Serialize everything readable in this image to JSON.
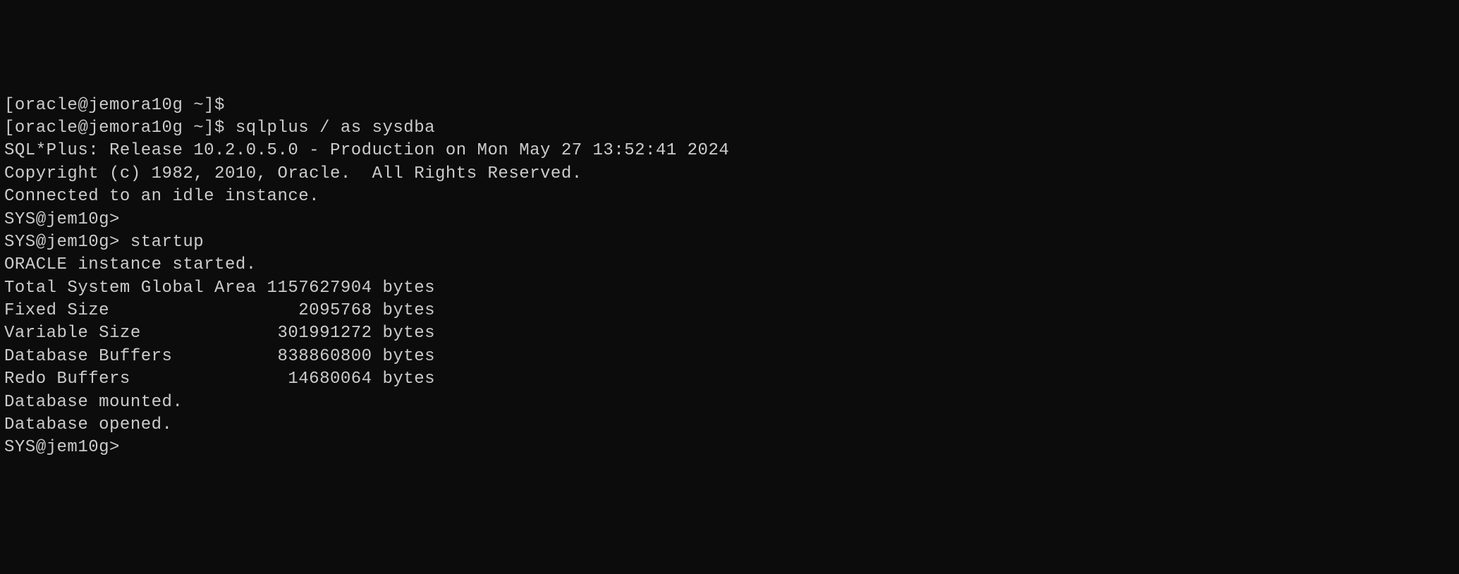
{
  "lines": {
    "l0": "[oracle@jemora10g ~]$",
    "l1": "[oracle@jemora10g ~]$ sqlplus / as sysdba",
    "l2": "",
    "l3": "SQL*Plus: Release 10.2.0.5.0 - Production on Mon May 27 13:52:41 2024",
    "l4": "",
    "l5": "Copyright (c) 1982, 2010, Oracle.  All Rights Reserved.",
    "l6": "",
    "l7": "Connected to an idle instance.",
    "l8": "",
    "l9": "SYS@jem10g>",
    "l10": "SYS@jem10g> startup",
    "l11": "ORACLE instance started.",
    "l12": "",
    "l13": "Total System Global Area 1157627904 bytes",
    "l14": "Fixed Size                  2095768 bytes",
    "l15": "Variable Size             301991272 bytes",
    "l16": "Database Buffers          838860800 bytes",
    "l17": "Redo Buffers               14680064 bytes",
    "l18": "Database mounted.",
    "l19": "Database opened.",
    "l20": "SYS@jem10g>"
  }
}
